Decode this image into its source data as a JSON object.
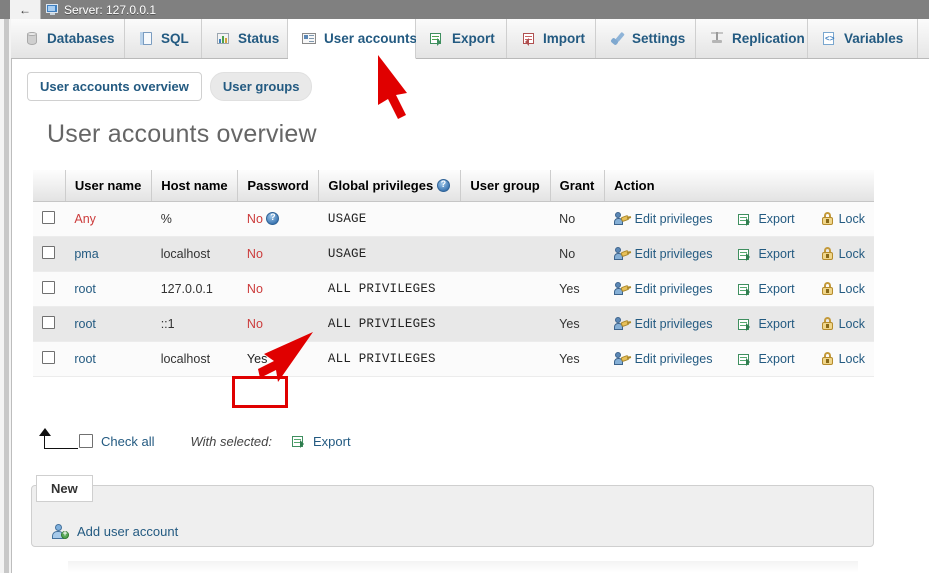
{
  "server_bar": {
    "back_icon": "back-arrow-icon",
    "monitor_icon": "monitor-icon",
    "label": "Server: 127.0.0.1"
  },
  "main_tabs": [
    {
      "label": "Databases",
      "icon": "database-icon",
      "active": false
    },
    {
      "label": "SQL",
      "icon": "sql-icon",
      "active": false
    },
    {
      "label": "Status",
      "icon": "status-chart-icon",
      "active": false
    },
    {
      "label": "User accounts",
      "icon": "user-card-icon",
      "active": true
    },
    {
      "label": "Export",
      "icon": "export-icon",
      "active": false
    },
    {
      "label": "Import",
      "icon": "import-icon",
      "active": false
    },
    {
      "label": "Settings",
      "icon": "wrench-icon",
      "active": false
    },
    {
      "label": "Replication",
      "icon": "replication-icon",
      "active": false
    },
    {
      "label": "Variables",
      "icon": "variables-icon",
      "active": false
    }
  ],
  "sub_tabs": [
    {
      "label": "User accounts overview",
      "selected": true
    },
    {
      "label": "User groups",
      "selected": false
    }
  ],
  "page_title": "User accounts overview",
  "table": {
    "columns": [
      "",
      "User name",
      "Host name",
      "Password",
      "Global privileges",
      "User group",
      "Grant",
      "Action"
    ],
    "global_privileges_help_icon": "help-icon",
    "rows": [
      {
        "user_name": "Any",
        "user_name_style": "any",
        "host_name": "%",
        "password": "No",
        "password_has_help": true,
        "global_privileges": "USAGE",
        "user_group": "",
        "grant": "No",
        "actions": [
          "Edit privileges",
          "Export",
          "Lock"
        ],
        "password_highlighted": false
      },
      {
        "user_name": "pma",
        "user_name_style": "link",
        "host_name": "localhost",
        "password": "No",
        "password_has_help": false,
        "global_privileges": "USAGE",
        "user_group": "",
        "grant": "No",
        "actions": [
          "Edit privileges",
          "Export",
          "Lock"
        ],
        "password_highlighted": false
      },
      {
        "user_name": "root",
        "user_name_style": "link",
        "host_name": "127.0.0.1",
        "password": "No",
        "password_has_help": false,
        "global_privileges": "ALL PRIVILEGES",
        "user_group": "",
        "grant": "Yes",
        "actions": [
          "Edit privileges",
          "Export",
          "Lock"
        ],
        "password_highlighted": false
      },
      {
        "user_name": "root",
        "user_name_style": "link",
        "host_name": "::1",
        "password": "No",
        "password_has_help": false,
        "global_privileges": "ALL PRIVILEGES",
        "user_group": "",
        "grant": "Yes",
        "actions": [
          "Edit privileges",
          "Export",
          "Lock"
        ],
        "password_highlighted": false
      },
      {
        "user_name": "root",
        "user_name_style": "link",
        "host_name": "localhost",
        "password": "Yes",
        "password_has_help": false,
        "global_privileges": "ALL PRIVILEGES",
        "user_group": "",
        "grant": "Yes",
        "actions": [
          "Edit privileges",
          "Export",
          "Lock"
        ],
        "password_highlighted": true
      }
    ]
  },
  "bottom_toolbar": {
    "arrow_icon": "select-all-arrow-icon",
    "check_all_label": "Check all",
    "with_selected_label": "With selected:",
    "export_label": "Export",
    "export_icon": "export-icon"
  },
  "new_panel": {
    "legend": "New",
    "add_user_label": "Add user account",
    "add_user_icon": "add-user-icon"
  },
  "annotations": {
    "arrow_color": "#e00000",
    "highlight_box_color": "#e00000",
    "arrow_to_tab": "User accounts",
    "arrow_to_cell": "Yes"
  },
  "colors": {
    "link": "#235a81",
    "danger": "#cc3b3b",
    "header_bg": "#e3e3e3",
    "row_odd": "#fbfbfb",
    "row_even": "#e8e8e8",
    "server_bar": "#808080"
  }
}
